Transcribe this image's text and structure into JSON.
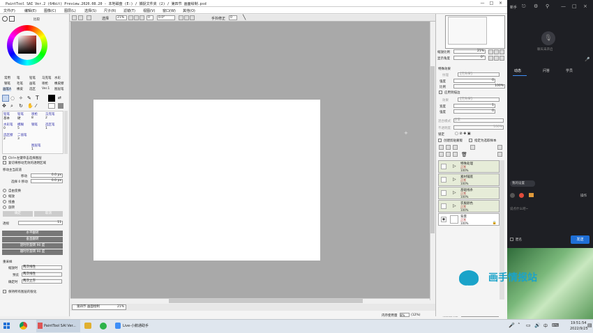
{
  "window": {
    "title": "PaintTool SAI Ver.2 (64bit) Preview.2020.08.20 - 本地磁盘 (E:) / 捕捉文件夹 (2) / 第四节 画面绘制.psd",
    "controls": [
      "—",
      "□",
      "×"
    ]
  },
  "menu": [
    "文件(F)",
    "编辑(E)",
    "图像(C)",
    "图层(L)",
    "选择(S)",
    "尺子(R)",
    "滤镜(T)",
    "视图(V)",
    "窗口(W)",
    "其他(O)"
  ],
  "toolbar": {
    "select_label": "选择",
    "zoom": "21%",
    "zoom_value": "0",
    "rotation": "0.0°",
    "stabilizer_label": "手抖修正",
    "stabilizer_value": "0"
  },
  "left_panel": {
    "color_tab": "比较",
    "brush_row1": [
      "常用",
      "笔",
      "铅笔",
      "马克笔",
      "水彩"
    ],
    "brush_row2": [
      "钢笔",
      "毛笔",
      "画笔",
      "喷枪",
      "橡皮擦"
    ],
    "brush_row3": [
      "画笔A",
      "橡皮",
      "选区",
      "Ver.1",
      "图层笔"
    ],
    "tool_sets": [
      {
        "name": "铅笔",
        "sub": "基本"
      },
      {
        "name": "铅笔",
        "sub": "硬"
      },
      {
        "name": "喷枪",
        "sub": "8"
      },
      {
        "name": "马克笔",
        "sub": "2"
      },
      {
        "name": "水彩笔",
        "sub": "0"
      },
      {
        "name": "模糊",
        "sub": "5"
      },
      {
        "name": "钢笔",
        "sub": ""
      },
      {
        "name": "选区笔",
        "sub": "1"
      },
      {
        "name": "选区擦",
        "sub": "2"
      },
      {
        "name": "二值笔",
        "sub": "3"
      },
      {
        "name": "图层笔",
        "sub": "1"
      }
    ],
    "option1": "Ctrl+左键单击选择图层",
    "option2": "复切将移动无效的透明区域",
    "move_section_title": "移动主当前道",
    "move_x_label": "移动",
    "move_x_value": "0.0 px",
    "move_y_label": "选择 0 移动",
    "move_y_value": "0.0 px",
    "transform_options": [
      "自由变换",
      "缩放",
      "扭曲",
      "旋转"
    ],
    "ok_label": "确定",
    "cancel_label": "取消",
    "opacity_label": "透视",
    "opacity_value": "11",
    "flip_buttons": [
      "水平翻转",
      "垂直翻转",
      "逆时针旋转 90 度",
      "顺时针旋转 90 度"
    ],
    "resample_title": "重采样",
    "resample_rows": [
      {
        "label": "缩放时",
        "value": "两次线性"
      },
      {
        "label": "预览",
        "value": "两次线性"
      },
      {
        "label": "确定时",
        "value": "两次立方"
      }
    ],
    "keep_option": "保持所有图层的锐化"
  },
  "right_panel": {
    "zoom_label": "缩放比例",
    "zoom_value": "21%",
    "angle_label": "显示角度",
    "angle_value": "0°",
    "effects_title": "特殊效果",
    "texture_label": "纹理",
    "texture_value": "【无效果】",
    "strength_label": "强度",
    "strength_value": "0",
    "scale_label": "比例",
    "scale_value": "100%",
    "apply_label": "应用到描边",
    "effect_label": "效果",
    "effect_value": "【无效果】",
    "width_label": "宽度",
    "width_value": "1",
    "intensity_label": "强度",
    "intensity_value": "0",
    "blend_label": "混合模式",
    "blend_value": "正常",
    "opacity_label": "不透明度",
    "opacity_value": "100%",
    "lock_label": "锁定",
    "clip_label": "创建剪贴蒙版",
    "ref_label": "指定为选取样本",
    "layers": [
      {
        "name": "特殊处理",
        "mode": "正常",
        "opacity": "100%"
      },
      {
        "name": "素材铺底",
        "mode": "正常",
        "opacity": "100%"
      },
      {
        "name": "基础线条",
        "mode": "正常",
        "opacity": "100%"
      },
      {
        "name": "衣服颜色",
        "mode": "正常",
        "opacity": "100%"
      },
      {
        "name": "背景",
        "mode": "正常",
        "opacity": "100%"
      }
    ]
  },
  "document_tab": {
    "name": "第四节 画面绘制",
    "zoom": "21%"
  },
  "status": {
    "memory_label": "内存使用量",
    "memory_value": "8%",
    "memory_detail": "(12%)",
    "disk_label": "磁盘使用量",
    "disk_value": "69%"
  },
  "chat": {
    "top_label": "新手",
    "status_text": "聊天未开启",
    "tabs": [
      "动态",
      "问答",
      "学员"
    ],
    "settings_label": "我的设置",
    "input_placeholder": "说点什么吧~",
    "operation_label": "操作",
    "checkbox_label": "匿名",
    "send_button": "发送",
    "banner_text": "画手情报站",
    "banner_sub": "HONGHIT"
  },
  "taskbar": {
    "apps": [
      "PaintTool SAI Ver...",
      "Live-小鹅通助手"
    ],
    "time": "19:51:54",
    "date": "2022/9/25"
  },
  "colors": {
    "accent_blue": "#1f6fd6",
    "layer_bg": "#e6ecd8",
    "chat_bg": "#1e1f24",
    "canvas_bg": "#a9a9a9"
  }
}
